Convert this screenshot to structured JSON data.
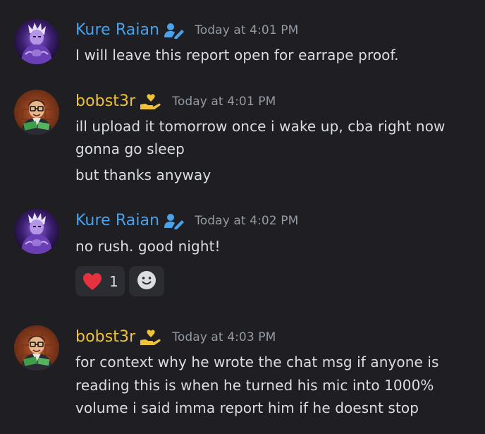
{
  "colors": {
    "background": "#1e1e23",
    "kure_name": "#4aa3ea",
    "bobst_name": "#f0c238",
    "timestamp": "#949ba4",
    "text": "#dbdee1",
    "reaction_bg": "#2b2d33"
  },
  "messages": [
    {
      "username": "Kure Raian",
      "role_icon": "user-edit-icon",
      "timestamp": "Today at 4:01 PM",
      "lines": [
        "I will leave this report open for earrape proof."
      ]
    },
    {
      "username": "bobst3r",
      "role_icon": "hand-heart-icon",
      "timestamp": "Today at 4:01 PM",
      "lines": [
        "ill upload it tomorrow once i wake up, cba right now",
        "gonna go sleep",
        "but thanks anyway"
      ]
    },
    {
      "username": "Kure Raian",
      "role_icon": "user-edit-icon",
      "timestamp": "Today at 4:02 PM",
      "lines": [
        "no rush. good night!"
      ],
      "reaction": {
        "emoji": "heart-icon",
        "count": "1"
      },
      "add_reaction_icon": "smiley-icon"
    },
    {
      "username": "bobst3r",
      "role_icon": "hand-heart-icon",
      "timestamp": "Today at 4:03 PM",
      "lines": [
        "for context why he wrote the chat msg if anyone is",
        "reading this is when he turned his mic into 1000%",
        "volume i said imma report him if he doesnt stop"
      ]
    }
  ]
}
